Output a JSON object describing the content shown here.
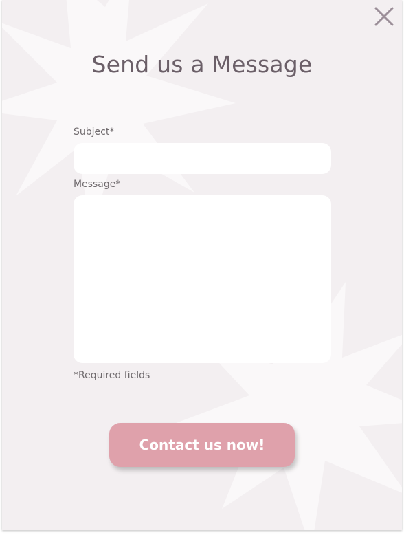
{
  "dialog": {
    "title": "Send us a Message",
    "close_icon": "close-icon"
  },
  "form": {
    "subject_label": "Subject*",
    "subject_value": "",
    "message_label": "Message*",
    "message_value": "",
    "required_note": "*Required fields",
    "submit_label": "Contact us now!"
  },
  "colors": {
    "background": "#f3eff1",
    "title_text": "#6b5f68",
    "button": "#dfa1ab",
    "close_icon": "#9b8e98"
  }
}
